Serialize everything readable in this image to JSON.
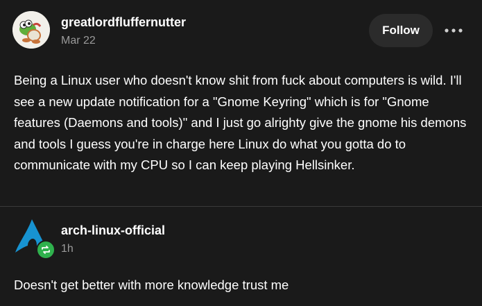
{
  "post": {
    "username": "greatlordfluffernutter",
    "timestamp": "Mar 22",
    "follow_label": "Follow",
    "more_icon": "more-horizontal-icon",
    "body": "Being a Linux user who doesn't know shit from fuck about computers is wild. I'll see a new update notification for a \"Gnome Keyring\" which is for \"Gnome features (Daemons and tools)\" and I just go alrighty give the gnome his demons and tools I guess you're in charge here Linux do what you gotta do to communicate with my CPU so I can keep playing Hellsinker."
  },
  "reblog": {
    "username": "arch-linux-official",
    "timestamp": "1h",
    "badge_icon": "reblog-icon",
    "body": "Doesn't get better with more knowledge trust me"
  },
  "colors": {
    "background": "#1a1a1a",
    "muted_text": "#9a9a9a",
    "reblog_green": "#2fb14d",
    "arch_blue": "#1793d1"
  }
}
